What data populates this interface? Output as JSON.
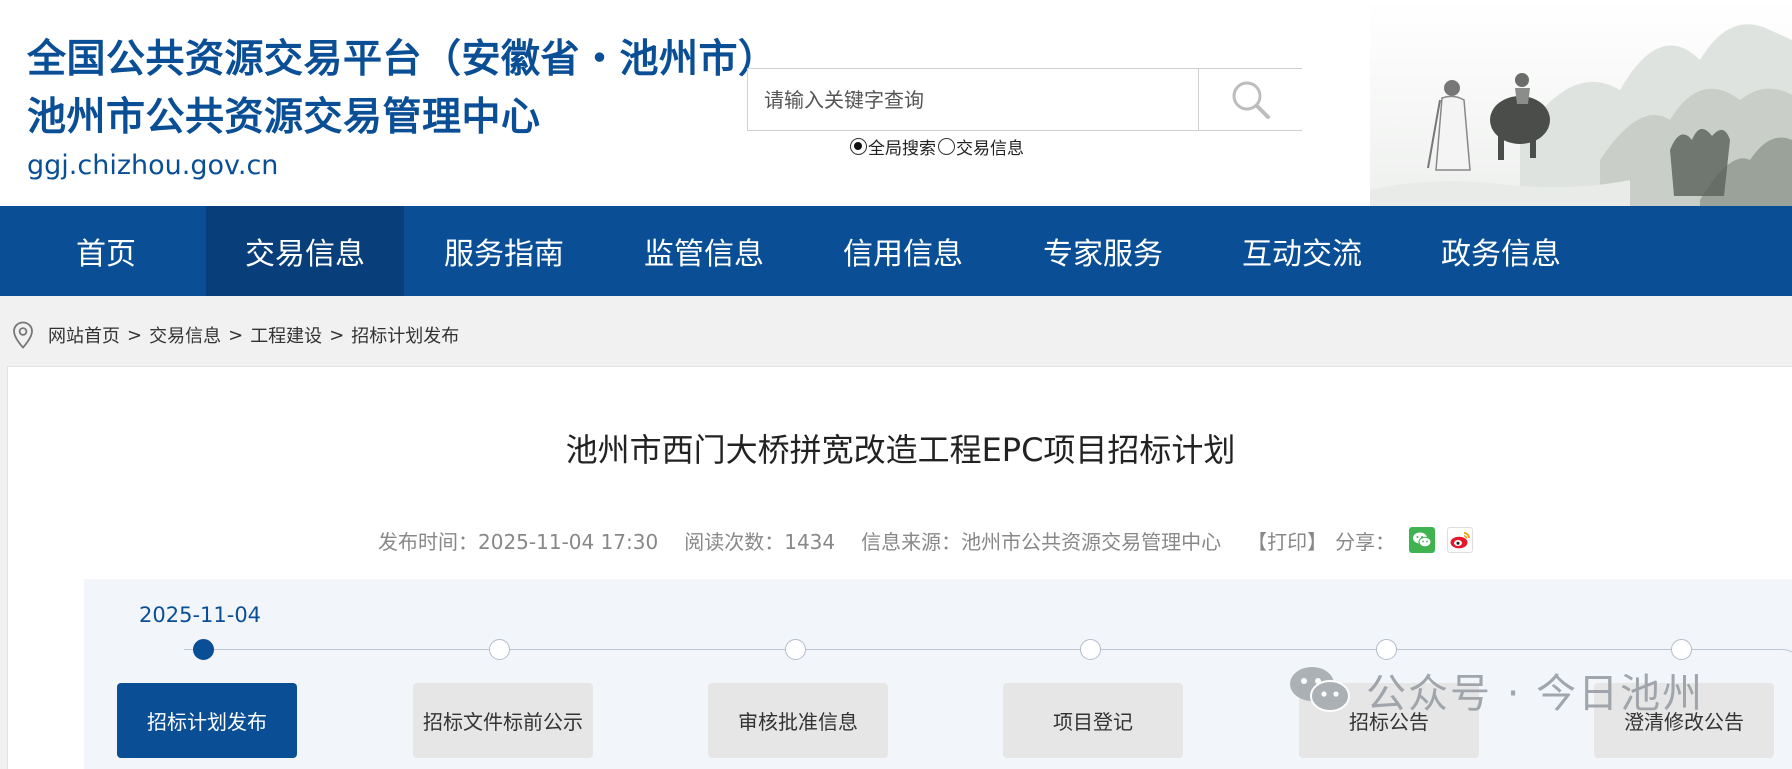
{
  "header": {
    "title_line1": "全国公共资源交易平台（安徽省・池州市）",
    "title_line2": "池州市公共资源交易管理中心",
    "domain": "ggj.chizhou.gov.cn"
  },
  "search": {
    "placeholder": "请输入关键字查询",
    "value": "",
    "options": [
      {
        "label": "全局搜索",
        "checked": true
      },
      {
        "label": "交易信息",
        "checked": false
      }
    ]
  },
  "nav": {
    "items": [
      {
        "label": "首页"
      },
      {
        "label": "交易信息",
        "active": true
      },
      {
        "label": "服务指南"
      },
      {
        "label": "监管信息"
      },
      {
        "label": "信用信息"
      },
      {
        "label": "专家服务"
      },
      {
        "label": "互动交流"
      },
      {
        "label": "政务信息"
      }
    ]
  },
  "breadcrumb": {
    "items": [
      "网站首页",
      "交易信息",
      "工程建设",
      "招标计划发布"
    ],
    "separator": ">"
  },
  "article": {
    "title": "池州市西门大桥拼宽改造工程EPC项目招标计划",
    "publish_time": "发布时间：2025-11-04 17:30",
    "read_count": "阅读次数：1434",
    "source": "信息来源：池州市公共资源交易管理中心",
    "print": "【打印】",
    "share": "分享："
  },
  "timeline": {
    "date": "2025-11-04",
    "steps": [
      {
        "label": "招标计划发布",
        "active": true
      },
      {
        "label": "招标文件标前公示"
      },
      {
        "label": "审核批准信息"
      },
      {
        "label": "项目登记"
      },
      {
        "label": "招标公告"
      },
      {
        "label": "澄清修改公告"
      }
    ]
  },
  "watermark": {
    "text": "公众号 · 今日池州"
  },
  "icons": {
    "search": "search-icon",
    "location": "location-pin-icon",
    "wechat": "wechat-icon",
    "weibo": "weibo-icon"
  },
  "colors": {
    "brand": "#0a4f96",
    "nav_active": "#083f7a",
    "wechat": "#3fb34f",
    "weibo": "#e6162d"
  }
}
